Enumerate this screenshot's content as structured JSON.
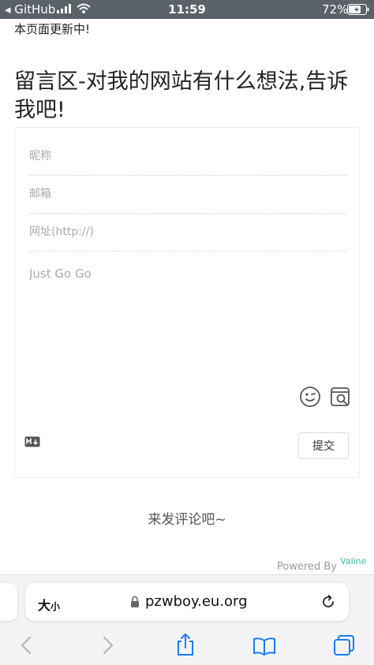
{
  "status_bar": {
    "back_app": "◂ GitHub",
    "time": "11:59",
    "battery": "72%"
  },
  "notice": "本页面更新中!",
  "title": "留言区-对我的网站有什么想法,告诉我吧!",
  "form": {
    "nick_placeholder": "昵称",
    "mail_placeholder": "邮箱",
    "link_placeholder": "网址(http://)",
    "comment_placeholder": "Just Go Go",
    "submit_label": "提交"
  },
  "empty_text": "来发评论吧~",
  "powered": {
    "prefix": "Powered By",
    "brand": "Valine"
  },
  "browser": {
    "text_size_label": "大",
    "text_size_small": "小",
    "url": "pzwboy.eu.org"
  },
  "colors": {
    "status_bar": "#5b6168",
    "valine_brand": "#3bbfa5",
    "toolbar_active": "#1a7cf5"
  }
}
